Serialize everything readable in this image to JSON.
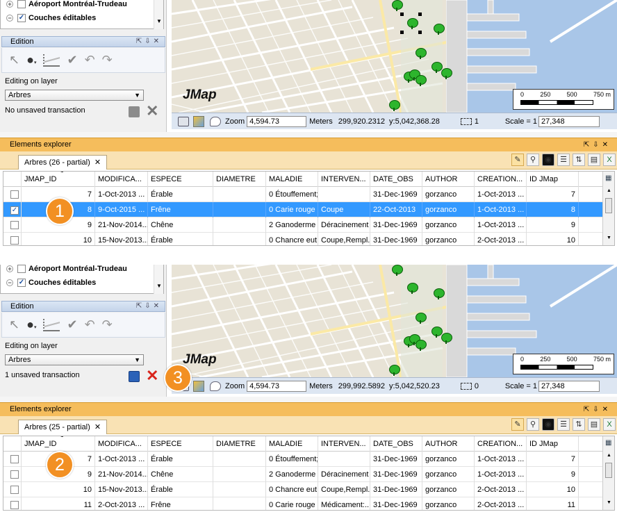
{
  "panels": [
    {
      "layers": [
        {
          "name": "Aéroport Montréal-Trudeau",
          "expand": "+",
          "checked": false
        },
        {
          "name": "Couches éditables",
          "expand": "−",
          "checked": true
        }
      ],
      "edition_title": "Edition",
      "editing_label": "Editing on layer",
      "layer_select": "Arbres",
      "transaction_status": "No unsaved transaction",
      "map_logo": "JMap",
      "zoom_label": "Zoom",
      "zoom_value": "4,594.73",
      "units": "Meters",
      "x_coord": "299,920.2312",
      "y_coord": "y:5,042,368.28",
      "selection_count": "1",
      "scale_label": "Scale = 1",
      "scale_value": "27,348",
      "scalebar": [
        "0",
        "250",
        "500",
        "750 m"
      ],
      "explorer_title": "Elements explorer",
      "tab_label": "Arbres (26 - partial)",
      "callout": "1",
      "rows": [
        {
          "checked": false,
          "selected": false,
          "id": "7",
          "modif": "1-Oct-2013 ...",
          "espece": "Érable",
          "diametre": "",
          "maladie": "0 Étouffement;...",
          "interv": "",
          "date_obs": "31-Dec-1969",
          "author": "gorzanco",
          "creation": "1-Oct-2013 ...",
          "idjmap": "7"
        },
        {
          "checked": true,
          "selected": true,
          "id": "8",
          "modif": "9-Oct-2015 ...",
          "espece": "Frêne",
          "diametre": "",
          "maladie": "0 Carie rouge ...",
          "interv": "Coupe",
          "date_obs": "22-Oct-2013",
          "author": "gorzanco",
          "creation": "1-Oct-2013 ...",
          "idjmap": "8"
        },
        {
          "checked": false,
          "selected": false,
          "id": "9",
          "modif": "21-Nov-2014...",
          "espece": "Chêne",
          "diametre": "",
          "maladie": "2 Ganoderme ...",
          "interv": "Déracinement",
          "date_obs": "31-Dec-1969",
          "author": "gorzanco",
          "creation": "1-Oct-2013 ...",
          "idjmap": "9"
        },
        {
          "checked": false,
          "selected": false,
          "id": "10",
          "modif": "15-Nov-2013...",
          "espece": "Érable",
          "diametre": "",
          "maladie": "0 Chancre eut...",
          "interv": "Coupe,Rempl...",
          "date_obs": "31-Dec-1969",
          "author": "gorzanco",
          "creation": "2-Oct-2013 ...",
          "idjmap": "10"
        }
      ]
    },
    {
      "layers": [
        {
          "name": "Aéroport Montréal-Trudeau",
          "expand": "+",
          "checked": false
        },
        {
          "name": "Couches éditables",
          "expand": "−",
          "checked": true
        }
      ],
      "edition_title": "Edition",
      "editing_label": "Editing on layer",
      "layer_select": "Arbres",
      "transaction_status": "1 unsaved transaction",
      "map_logo": "JMap",
      "zoom_label": "Zoom",
      "zoom_value": "4,594.73",
      "units": "Meters",
      "x_coord": "299,992.5892",
      "y_coord": "y:5,042,520.23",
      "selection_count": "0",
      "scale_label": "Scale = 1",
      "scale_value": "27,348",
      "scalebar": [
        "0",
        "250",
        "500",
        "750 m"
      ],
      "explorer_title": "Elements explorer",
      "tab_label": "Arbres (25 - partial)",
      "callout": "2",
      "callout_save": "3",
      "rows": [
        {
          "checked": false,
          "selected": false,
          "id": "7",
          "modif": "1-Oct-2013 ...",
          "espece": "Érable",
          "diametre": "",
          "maladie": "0 Étouffement;...",
          "interv": "",
          "date_obs": "31-Dec-1969",
          "author": "gorzanco",
          "creation": "1-Oct-2013 ...",
          "idjmap": "7"
        },
        {
          "checked": false,
          "selected": false,
          "id": "9",
          "modif": "21-Nov-2014...",
          "espece": "Chêne",
          "diametre": "",
          "maladie": "2 Ganoderme ...",
          "interv": "Déracinement",
          "date_obs": "31-Dec-1969",
          "author": "gorzanco",
          "creation": "1-Oct-2013 ...",
          "idjmap": "9"
        },
        {
          "checked": false,
          "selected": false,
          "id": "10",
          "modif": "15-Nov-2013...",
          "espece": "Érable",
          "diametre": "",
          "maladie": "0 Chancre eut...",
          "interv": "Coupe,Rempl...",
          "date_obs": "31-Dec-1969",
          "author": "gorzanco",
          "creation": "2-Oct-2013 ...",
          "idjmap": "10"
        },
        {
          "checked": false,
          "selected": false,
          "id": "11",
          "modif": "2-Oct-2013 ...",
          "espece": "Frêne",
          "diametre": "",
          "maladie": "0 Carie rouge ...",
          "interv": "Médicament:...",
          "date_obs": "31-Dec-1969",
          "author": "gorzanco",
          "creation": "2-Oct-2013 ...",
          "idjmap": "11"
        }
      ]
    }
  ],
  "columns": [
    "JMAP_ID",
    "MODIFICA...",
    "ESPECE",
    "DIAMETRE",
    "MALADIE",
    "INTERVEN...",
    "DATE_OBS",
    "AUTHOR",
    "CREATION...",
    "ID JMap"
  ],
  "sort_indicator": "1",
  "tab_close": "✕",
  "icons": [
    "select-arrow-icon",
    "point-icon",
    "line-icon",
    "edit-node-icon",
    "undo-icon",
    "redo-icon",
    "save-icon",
    "cancel-icon",
    "pencil-icon",
    "magnifier-icon",
    "grid-icon",
    "sort-icon",
    "excel-icon",
    "tree-icon"
  ],
  "colors": {
    "explorer_header": "#f5bd5c",
    "selection": "#3399ff",
    "callout": "#f29023",
    "tree": "#2db52d",
    "cancel_active": "#d9241b"
  }
}
